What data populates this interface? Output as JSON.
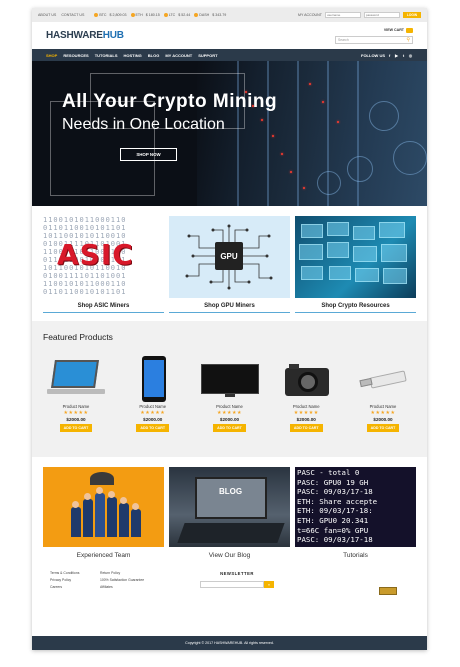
{
  "topbar": {
    "links": [
      "ABOUT US",
      "CONTACT US"
    ],
    "prices": [
      {
        "coin": "BTC",
        "value": "$ 2,809.03"
      },
      {
        "coin": "ETH",
        "value": "$ 180.15"
      },
      {
        "coin": "LTC",
        "value": "$ 52.44"
      },
      {
        "coin": "DASH",
        "value": "$ 343.79"
      }
    ],
    "account_label": "MY ACCOUNT",
    "username_placeholder": "username",
    "password_placeholder": "password",
    "login_label": "LOGIN"
  },
  "header": {
    "logo_main": "HASHWARE",
    "logo_accent": "HUB",
    "cart_label": "VIEW CART",
    "search_placeholder": "Search"
  },
  "nav": {
    "items": [
      "SHOP",
      "RESOURCES",
      "TUTORIALS",
      "HOSTING",
      "BLOG",
      "MY ACCOUNT",
      "SUPPORT"
    ],
    "follow_label": "FOLLOW US",
    "social": [
      "f",
      "▶",
      "t",
      "◎"
    ]
  },
  "hero": {
    "title": "All Your Crypto Mining",
    "subtitle": "Needs in One Location",
    "button": "SHOP NOW"
  },
  "categories": [
    {
      "label": "Shop ASIC Miners",
      "image_text": "ASIC"
    },
    {
      "label": "Shop GPU Miners",
      "image_text": "GPU"
    },
    {
      "label": "Shop Crypto Resources"
    }
  ],
  "featured": {
    "title": "Featured Products",
    "products": [
      {
        "name": "Product Name",
        "rating": "★★★★★",
        "price": "$2000.00",
        "button": "ADD TO CART",
        "icon": "laptop-icon"
      },
      {
        "name": "Product Name",
        "rating": "★★★★★",
        "price": "$2000.00",
        "button": "ADD TO CART",
        "icon": "phone-icon"
      },
      {
        "name": "Product Name",
        "rating": "★★★★★",
        "price": "$2000.00",
        "button": "ADD TO CART",
        "icon": "tv-icon"
      },
      {
        "name": "Product Name",
        "rating": "★★★★★",
        "price": "$2000.00",
        "button": "ADD TO CART",
        "icon": "camera-icon"
      },
      {
        "name": "Product Name",
        "rating": "★★★★★",
        "price": "$2000.00",
        "button": "ADD TO CART",
        "icon": "usb-icon"
      }
    ]
  },
  "promos": [
    {
      "label": "Experienced Team"
    },
    {
      "label": "View Our Blog",
      "image_text": "BLOG"
    },
    {
      "label": "Tutorials",
      "code_lines": [
        "PASC - total 0",
        "PASC: GPU0 19 GH",
        "PASC: 09/03/17-18",
        "ETH: Share accepte",
        "ETH: 09/03/17-18:",
        "ETH: GPU0 20.341",
        "   t=66C fan=0% GPU",
        "PASC: 09/03/17-18"
      ]
    }
  ],
  "footer": {
    "col1": [
      "Terms & Conditions",
      "Privacy Policy",
      "Careers"
    ],
    "col2": [
      "Return Policy",
      "100% Satisfaction Guarantee",
      "Affiliates"
    ],
    "newsletter_title": "NEWSLETTER",
    "newsletter_button": "»",
    "copyright": "Copyright © 2017 HASHWAREHUB. All rights reserved."
  }
}
